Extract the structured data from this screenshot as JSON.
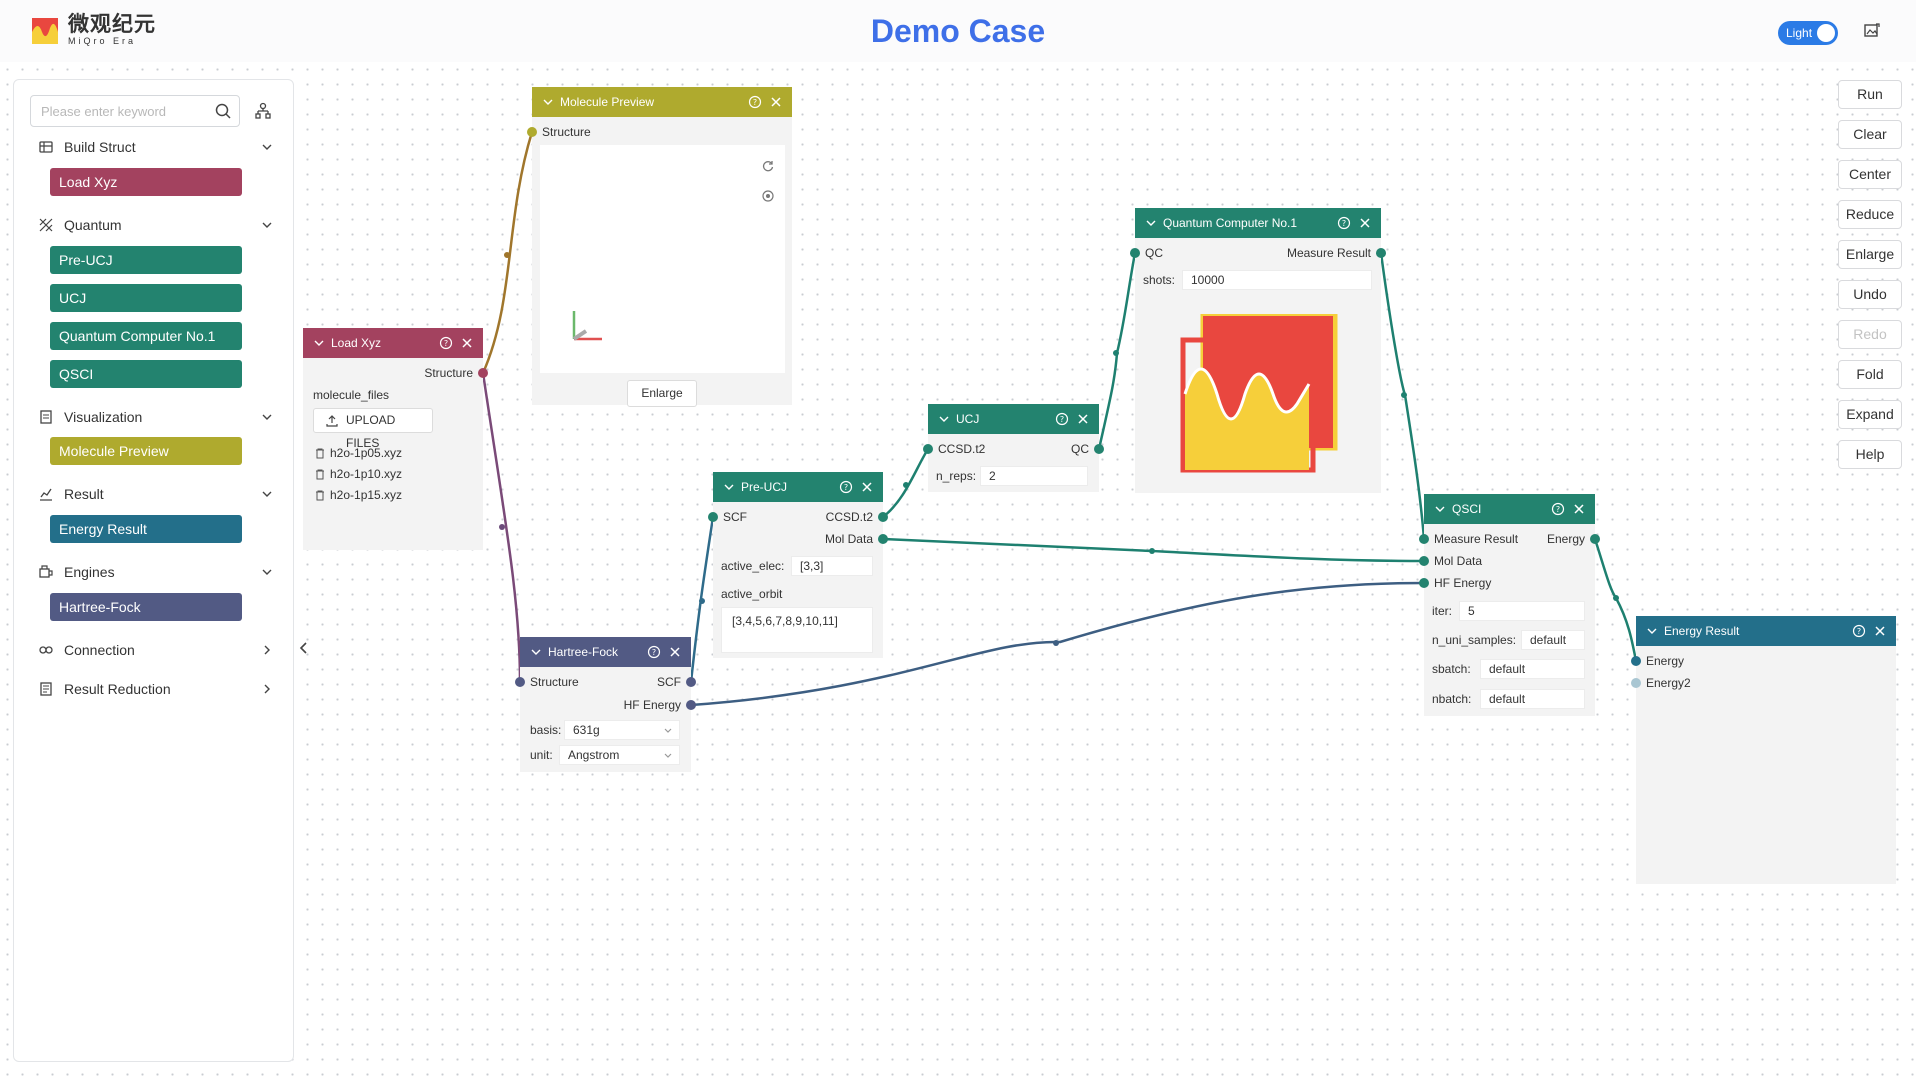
{
  "header": {
    "logo_cn": "微观纪元",
    "logo_en": "MiQro Era",
    "title": "Demo Case",
    "theme_toggle": "Light"
  },
  "sidebar": {
    "search_placeholder": "Please enter keyword",
    "categories": [
      {
        "label": "Build Struct",
        "icon": "build-icon",
        "expanded": true,
        "items": [
          "Load Xyz"
        ]
      },
      {
        "label": "Quantum",
        "icon": "quantum-icon",
        "expanded": true,
        "items": [
          "Pre-UCJ",
          "UCJ",
          "Quantum Computer No.1",
          "QSCI"
        ]
      },
      {
        "label": "Visualization",
        "icon": "visualization-icon",
        "expanded": true,
        "items": [
          "Molecule Preview"
        ]
      },
      {
        "label": "Result",
        "icon": "result-icon",
        "expanded": true,
        "items": [
          "Energy Result"
        ]
      },
      {
        "label": "Engines",
        "icon": "engines-icon",
        "expanded": true,
        "items": [
          "Hartree-Fock"
        ]
      },
      {
        "label": "Connection",
        "icon": "connection-icon",
        "expanded": false,
        "items": []
      },
      {
        "label": "Result Reduction",
        "icon": "reduction-icon",
        "expanded": false,
        "items": []
      }
    ]
  },
  "toolbar": [
    "Run",
    "Clear",
    "Center",
    "Reduce",
    "Enlarge",
    "Undo",
    "Redo",
    "Fold",
    "Expand",
    "Help"
  ],
  "colors": {
    "build": "#a3425f",
    "quantum": "#23836f",
    "visualization": "#afaa2e",
    "result": "#236f8a",
    "engines": "#525a84",
    "accent": "#3e6fe8"
  },
  "nodes": {
    "load_xyz": {
      "title": "Load Xyz",
      "out_structure": "Structure",
      "param_label": "molecule_files",
      "upload_label": "UPLOAD FILES",
      "files": [
        "h2o-1p05.xyz",
        "h2o-1p10.xyz",
        "h2o-1p15.xyz"
      ]
    },
    "molecule_preview": {
      "title": "Molecule Preview",
      "in_structure": "Structure",
      "enlarge_label": "Enlarge"
    },
    "hartree_fock": {
      "title": "Hartree-Fock",
      "in_structure": "Structure",
      "out_scf": "SCF",
      "out_hf_energy": "HF Energy",
      "basis_label": "basis:",
      "basis_value": "631g",
      "unit_label": "unit:",
      "unit_value": "Angstrom"
    },
    "pre_ucj": {
      "title": "Pre-UCJ",
      "in_scf": "SCF",
      "out_ccsd": "CCSD.t2",
      "out_mol": "Mol Data",
      "active_elec_label": "active_elec:",
      "active_elec_value": "[3,3]",
      "active_orbit_label": "active_orbit",
      "active_orbit_value": "[3,4,5,6,7,8,9,10,11]"
    },
    "ucj": {
      "title": "UCJ",
      "in_ccsd": "CCSD.t2",
      "out_qc": "QC",
      "n_reps_label": "n_reps:",
      "n_reps_value": "2"
    },
    "quantum_computer": {
      "title": "Quantum Computer No.1",
      "in_qc": "QC",
      "out_measure": "Measure Result",
      "shots_label": "shots:",
      "shots_value": "10000"
    },
    "qsci": {
      "title": "QSCI",
      "in_measure": "Measure Result",
      "in_mol": "Mol Data",
      "in_hf": "HF Energy",
      "out_energy": "Energy",
      "iter_label": "iter:",
      "iter_value": "5",
      "n_uni_label": "n_uni_samples:",
      "n_uni_value": "default",
      "sbatch_label": "sbatch:",
      "sbatch_value": "default",
      "nbatch_label": "nbatch:",
      "nbatch_value": "default"
    },
    "energy_result": {
      "title": "Energy Result",
      "in_energy": "Energy",
      "in_energy2": "Energy2"
    }
  }
}
